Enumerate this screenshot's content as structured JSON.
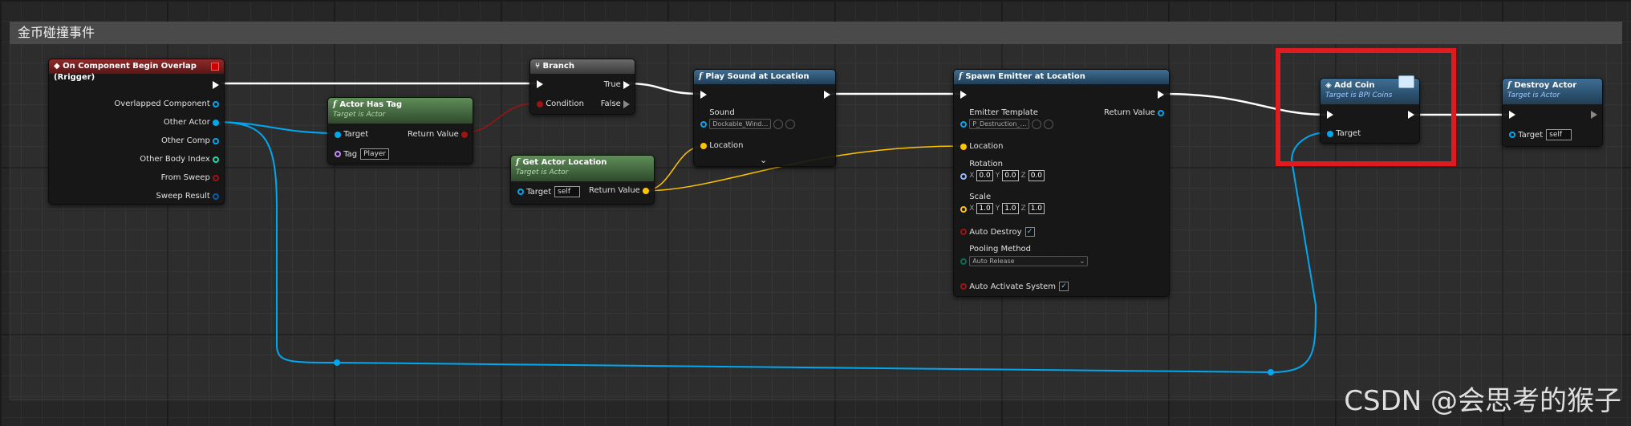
{
  "comment": {
    "title": "金币碰撞事件"
  },
  "event_node": {
    "title": "On Component Begin Overlap (Rrigger)",
    "pins": [
      "Overlapped Component",
      "Other Actor",
      "Other Comp",
      "Other Body Index",
      "From Sweep",
      "Sweep Result"
    ]
  },
  "actor_has_tag": {
    "title": "Actor Has Tag",
    "subtitle": "Target is Actor",
    "target": "Target",
    "tag": "Tag",
    "tag_value": "Player",
    "return_value": "Return Value"
  },
  "branch": {
    "title": "Branch",
    "condition": "Condition",
    "true_label": "True",
    "false_label": "False"
  },
  "get_actor_location": {
    "title": "Get Actor Location",
    "subtitle": "Target is Actor",
    "target": "Target",
    "target_value": "self",
    "return_value": "Return Value"
  },
  "play_sound": {
    "title": "Play Sound at Location",
    "sound": "Sound",
    "sound_value": "Dockable_Wind…",
    "location": "Location"
  },
  "spawn_emitter": {
    "title": "Spawn Emitter at Location",
    "emitter_template": "Emitter Template",
    "emitter_value": "P_Destruction_…",
    "return_value": "Return Value",
    "location": "Location",
    "rotation": "Rotation",
    "rotation_values": {
      "x": "0.0",
      "y": "0.0",
      "z": "0.0"
    },
    "scale": "Scale",
    "scale_values": {
      "x": "1.0",
      "y": "1.0",
      "z": "1.0"
    },
    "auto_destroy": "Auto Destroy",
    "pooling_method": "Pooling Method",
    "pooling_value": "Auto Release",
    "auto_activate": "Auto Activate System",
    "axis_x": "X",
    "axis_y": "Y",
    "axis_z": "Z"
  },
  "add_coin": {
    "title": "Add Coin",
    "subtitle": "Target is BPI Coins",
    "target": "Target"
  },
  "destroy_actor": {
    "title": "Destroy Actor",
    "subtitle": "Target is Actor",
    "target": "Target",
    "target_value": "self"
  },
  "watermark": "CSDN @会思考的猴子",
  "colors": {
    "exec": "#ffffff",
    "object": "#00a8f0",
    "vector": "#ffc400",
    "bool": "#a01313",
    "highlight": "#e01a1f"
  }
}
